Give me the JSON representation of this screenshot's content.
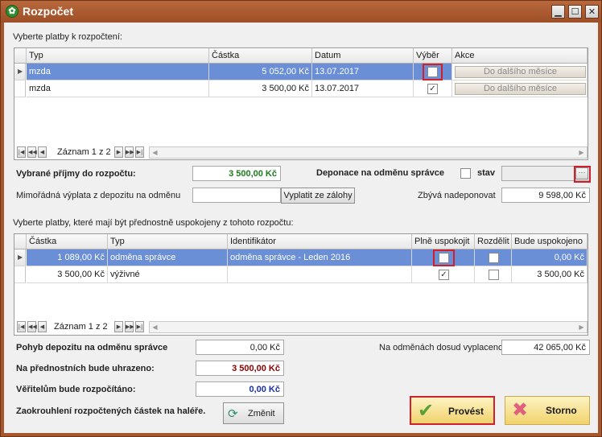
{
  "window": {
    "title": "Rozpočet",
    "controls": {
      "minimize": "▁",
      "maximize": "☐",
      "close": "✕"
    }
  },
  "top": {
    "section_label": "Vyberte platby k rozpočtení:",
    "columns": [
      "Typ",
      "Částka",
      "Datum",
      "Výběr",
      "Akce"
    ],
    "rows": [
      {
        "type": "mzda",
        "amount": "5 052,00 Kč",
        "date": "13.07.2017",
        "checked": false,
        "action": "Do dalšího měsíce",
        "selected": true
      },
      {
        "type": "mzda",
        "amount": "3 500,00 Kč",
        "date": "13.07.2017",
        "checked": true,
        "action": "Do dalšího měsíce",
        "selected": false
      }
    ],
    "navigator": {
      "record_text": "Záznam 1 z 2"
    }
  },
  "summary": {
    "income_label": "Vybrané příjmy do rozpočtu:",
    "income_value": "3 500,00 Kč",
    "deposit_label": "Deponace na odměnu správce",
    "state_label": "stav",
    "state_button": "···",
    "extra_label": "Mimořádná výplata z depozitu na odměnu",
    "extra_value": "",
    "extra_button": "Vyplatit ze zálohy",
    "remain_label": "Zbývá nadeponovat",
    "remain_value": "9 598,00 Kč"
  },
  "bottom": {
    "section_label": "Vyberte platby, které mají být přednostně uspokojeny z tohoto rozpočtu:",
    "columns": [
      "Částka",
      "Typ",
      "Identifikátor",
      "Plně uspokojit",
      "Rozdělit",
      "Bude uspokojeno"
    ],
    "rows": [
      {
        "amount": "1 089,00 Kč",
        "type": "odměna správce",
        "ident": "odměna správce - Leden 2016",
        "full": false,
        "split": false,
        "will": "0,00 Kč",
        "selected": true
      },
      {
        "amount": "3 500,00 Kč",
        "type": "výživné",
        "ident": "",
        "full": true,
        "split": false,
        "will": "3 500,00 Kč",
        "selected": false
      }
    ],
    "navigator": {
      "record_text": "Záznam 1 z 2"
    }
  },
  "footer": {
    "movement_label": "Pohyb depozitu na odměnu správce",
    "movement_value": "0,00 Kč",
    "paid_label": "Na odměnách dosud vyplaceno",
    "paid_value": "42 065,00 Kč",
    "priority_label": "Na přednostních bude uhrazeno:",
    "priority_value": "3 500,00 Kč",
    "creditors_label": "Věřitelům bude rozpočítáno:",
    "creditors_value": "0,00 Kč",
    "rounding_label": "Zaokrouhlení rozpočtených částek na haléře.",
    "change_button": "Změnit",
    "confirm_button": "Provést",
    "cancel_button": "Storno"
  },
  "colors": {
    "title_bar": "#a7562d",
    "selection": "#6a8fd6",
    "green_value": "#1d7a1d",
    "red_value": "#8b0000",
    "blue_value": "#1a2fa8",
    "highlight": "#d0202c"
  }
}
